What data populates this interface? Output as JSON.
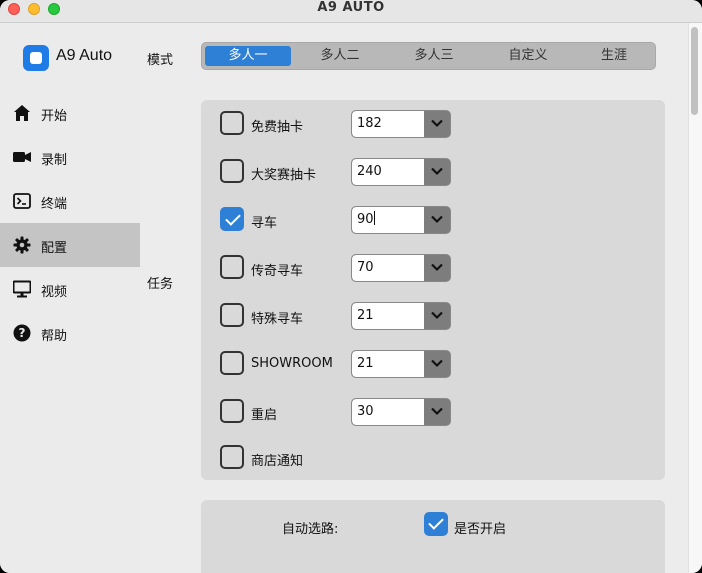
{
  "window": {
    "title": "A9 AUTO"
  },
  "sidebar": {
    "app_name": "A9 Auto",
    "items": [
      {
        "label": "开始",
        "icon": "home-icon",
        "active": false
      },
      {
        "label": "录制",
        "icon": "camera-icon",
        "active": false
      },
      {
        "label": "终端",
        "icon": "terminal-icon",
        "active": false
      },
      {
        "label": "配置",
        "icon": "gear-icon",
        "active": true
      },
      {
        "label": "视频",
        "icon": "monitor-icon",
        "active": false
      },
      {
        "label": "帮助",
        "icon": "help-icon",
        "active": false
      }
    ]
  },
  "mode": {
    "label": "模式",
    "options": [
      "多人一",
      "多人二",
      "多人三",
      "自定义",
      "生涯"
    ],
    "selected": "多人一"
  },
  "tasks": {
    "label": "任务",
    "rows": [
      {
        "name": "免费抽卡",
        "checked": false,
        "value": "182"
      },
      {
        "name": "大奖赛抽卡",
        "checked": false,
        "value": "240"
      },
      {
        "name": "寻车",
        "checked": true,
        "value": "90"
      },
      {
        "name": "传奇寻车",
        "checked": false,
        "value": "70"
      },
      {
        "name": "特殊寻车",
        "checked": false,
        "value": "21"
      },
      {
        "name": "SHOWROOM",
        "checked": false,
        "value": "21"
      },
      {
        "name": "重启",
        "checked": false,
        "value": "30"
      },
      {
        "name": "商店通知",
        "checked": false
      }
    ]
  },
  "auto_route": {
    "label": "自动选路:",
    "checkbox_label": "是否开启",
    "checked": true
  },
  "colors": {
    "accent": "#2e7fd6",
    "sidebar_active": "#c4c4c4"
  }
}
